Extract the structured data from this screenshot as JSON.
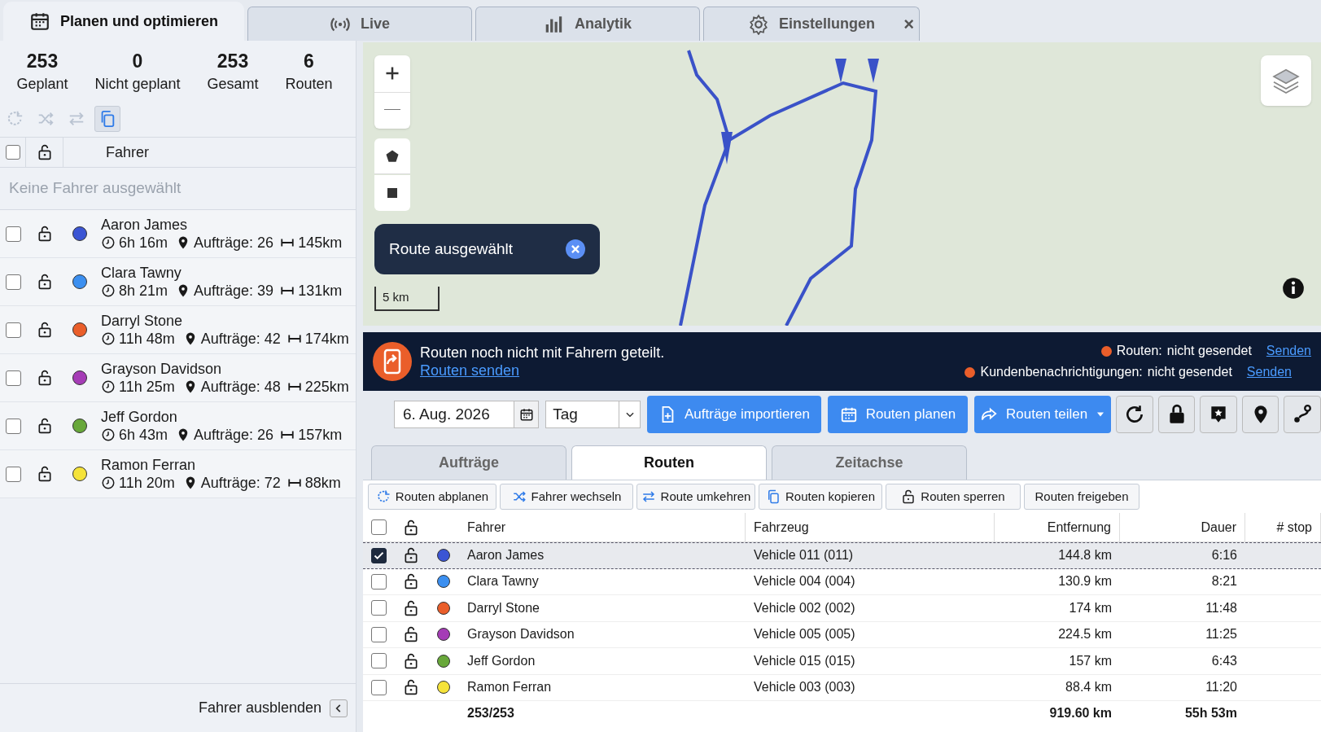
{
  "top_tabs": [
    {
      "label": "Planen und optimieren",
      "selected": true
    },
    {
      "label": "Live",
      "selected": false
    },
    {
      "label": "Analytik",
      "selected": false
    },
    {
      "label": "Einstellungen",
      "selected": false,
      "close": "×"
    }
  ],
  "summary": [
    {
      "value": "253",
      "label": "Geplant"
    },
    {
      "value": "0",
      "label": "Nicht geplant"
    },
    {
      "value": "253",
      "label": "Gesamt"
    },
    {
      "value": "6",
      "label": "Routen"
    }
  ],
  "left_toolbar": [
    {
      "selected": false
    },
    {
      "selected": false
    },
    {
      "selected": false
    },
    {
      "selected": true
    }
  ],
  "driver_list": {
    "all_checked": false,
    "header": "Fahrer",
    "empty_text": "Keine Fahrer ausgewählt",
    "drivers": [
      {
        "name": "Aaron James",
        "color": "#3b55d4",
        "checked": false,
        "duration": "6h 16m",
        "orders": "Aufträge: 26",
        "distance": "145km"
      },
      {
        "name": "Clara Tawny",
        "color": "#3b8ff0",
        "checked": false,
        "duration": "8h 21m",
        "orders": "Aufträge: 39",
        "distance": "131km"
      },
      {
        "name": "Darryl Stone",
        "color": "#ea5e2a",
        "checked": false,
        "duration": "11h 48m",
        "orders": "Aufträge: 42",
        "distance": "174km"
      },
      {
        "name": "Grayson Davidson",
        "color": "#a53cb6",
        "checked": false,
        "duration": "11h 25m",
        "orders": "Aufträge: 48",
        "distance": "225km"
      },
      {
        "name": "Jeff Gordon",
        "color": "#68a83a",
        "checked": false,
        "duration": "6h 43m",
        "orders": "Aufträge: 26",
        "distance": "157km"
      },
      {
        "name": "Ramon Ferran",
        "color": "#f5e33a",
        "checked": false,
        "duration": "11h 20m",
        "orders": "Aufträge: 72",
        "distance": "88km"
      }
    ]
  },
  "hide_drivers": {
    "label": "Fahrer ausblenden"
  },
  "map": {
    "popup": "Route ausgewählt",
    "scale": "5 km"
  },
  "banner": {
    "message": "Routen noch nicht mit Fahrern geteilt.",
    "link": "Routen senden",
    "statuses": [
      {
        "label": "Routen:",
        "value": "nicht gesendet",
        "action": "Senden",
        "color": "#ea5e2a"
      },
      {
        "label": "Kundenbenachrichtigungen:",
        "value": "nicht gesendet",
        "action": "Senden",
        "color": "#ea5e2a"
      }
    ]
  },
  "toolbar": {
    "date": "6. Aug. 2026",
    "period": "Tag",
    "buttons": [
      {
        "label": "Aufträge importieren"
      },
      {
        "label": "Routen planen"
      },
      {
        "label": "Routen teilen"
      }
    ]
  },
  "view_tabs": [
    {
      "label": "Aufträge",
      "selected": false
    },
    {
      "label": "Routen",
      "selected": true
    },
    {
      "label": "Zeitachse",
      "selected": false
    }
  ],
  "actions": [
    {
      "label": "Routen abplanen"
    },
    {
      "label": "Fahrer wechseln"
    },
    {
      "label": "Route umkehren"
    },
    {
      "label": "Routen kopieren"
    },
    {
      "label": "Routen sperren"
    },
    {
      "label": "Routen freigeben"
    }
  ],
  "table": {
    "all_checked": false,
    "columns": [
      "Fahrer",
      "Fahrzeug",
      "Entfernung",
      "Dauer",
      "# stop"
    ],
    "rows": [
      {
        "selected": true,
        "color": "#3b55d4",
        "driver": "Aaron James",
        "vehicle": "Vehicle 011 (011)",
        "distance": "144.8 km",
        "duration": "6:16"
      },
      {
        "selected": false,
        "color": "#3b8ff0",
        "driver": "Clara Tawny",
        "vehicle": "Vehicle 004 (004)",
        "distance": "130.9 km",
        "duration": "8:21"
      },
      {
        "selected": false,
        "color": "#ea5e2a",
        "driver": "Darryl Stone",
        "vehicle": "Vehicle 002 (002)",
        "distance": "174 km",
        "duration": "11:48"
      },
      {
        "selected": false,
        "color": "#a53cb6",
        "driver": "Grayson Davidson",
        "vehicle": "Vehicle 005 (005)",
        "distance": "224.5 km",
        "duration": "11:25"
      },
      {
        "selected": false,
        "color": "#68a83a",
        "driver": "Jeff Gordon",
        "vehicle": "Vehicle 015 (015)",
        "distance": "157 km",
        "duration": "6:43"
      },
      {
        "selected": false,
        "color": "#f5e33a",
        "driver": "Ramon Ferran",
        "vehicle": "Vehicle 003 (003)",
        "distance": "88.4 km",
        "duration": "11:20"
      }
    ],
    "totals": {
      "count": "253/253",
      "distance": "919.60 km",
      "duration": "55h 53m"
    }
  }
}
